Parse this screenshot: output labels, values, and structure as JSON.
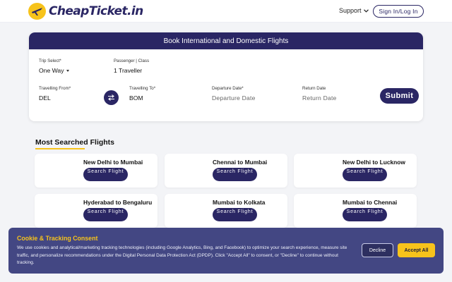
{
  "header": {
    "logo_text": "CheapTicket.in",
    "support_label": "Support",
    "signin_label": "Sign In/Log In"
  },
  "booking": {
    "heading": "Book International and Domestic Flights",
    "trip_select": {
      "label": "Trip Select*",
      "value": "One Way"
    },
    "passenger": {
      "label": "Passenger | Class",
      "value": "1 Traveller"
    },
    "from": {
      "label": "Travelling From*",
      "value": "DEL"
    },
    "to": {
      "label": "Travelling To*",
      "value": "BOM"
    },
    "departure": {
      "label": "Departure Date*",
      "placeholder": "Departure Date"
    },
    "return": {
      "label": "Return Date",
      "placeholder": "Return Date"
    },
    "submit_label": "Submit"
  },
  "most_searched": {
    "title": "Most Searched Flights",
    "button_label": "Search Flight",
    "routes": [
      "New Delhi to Mumbai",
      "Chennai to Mumbai",
      "New Delhi to Lucknow",
      "Hyderabad to Bengaluru",
      "Mumbai to Kolkata",
      "Mumbai to Chennai"
    ]
  },
  "cookie": {
    "title": "Cookie & Tracking Consent",
    "text": "We use cookies and analytical/marketing tracking technologies (including Google Analytics, Bing, and Facebook) to optimize your search experience, measure site traffic, and personalize recommendations under the Digital Personal Data Protection Act (DPDP). Click \"Accept All\" to consent, or \"Decline\" to continue without tracking.",
    "decline_label": "Decline",
    "accept_label": "Accept All"
  },
  "colors": {
    "brand_navy": "#2a2664",
    "brand_yellow": "#f7c31b",
    "banner_bg": "#434783"
  }
}
